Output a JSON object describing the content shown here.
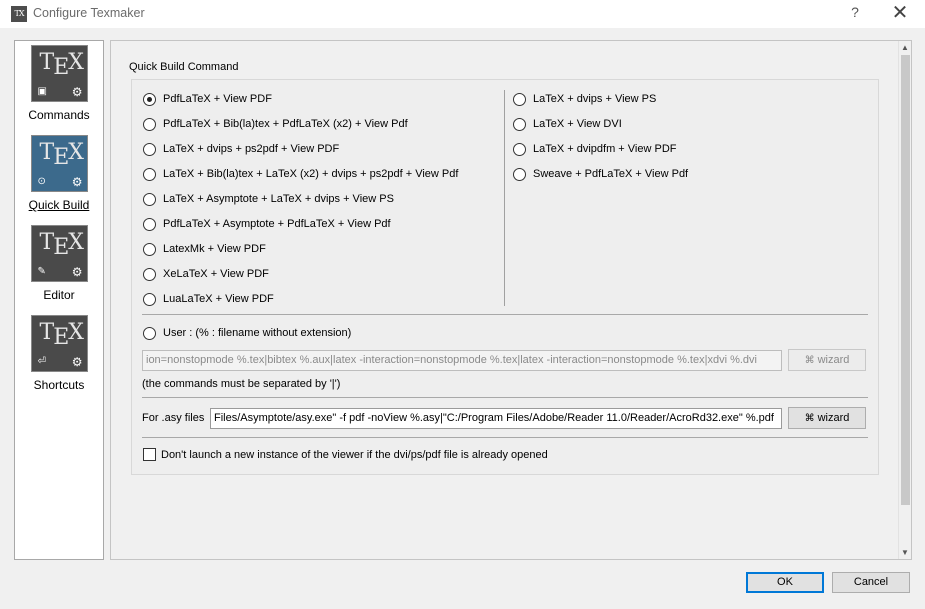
{
  "window": {
    "title": "Configure Texmaker",
    "help": "?",
    "close": "✕"
  },
  "sidebar": {
    "items": [
      {
        "label": "Commands",
        "icon": "commands-icon"
      },
      {
        "label": "Quick Build",
        "icon": "quick-build-icon",
        "selected": true
      },
      {
        "label": "Editor",
        "icon": "editor-icon"
      },
      {
        "label": "Shortcuts",
        "icon": "shortcuts-icon"
      }
    ],
    "icon_text": "TEX"
  },
  "quick_build": {
    "group_title": "Quick Build Command",
    "left_options": [
      "PdfLaTeX + View PDF",
      "PdfLaTeX + Bib(la)tex + PdfLaTeX (x2) + View Pdf",
      "LaTeX + dvips + ps2pdf + View PDF",
      "LaTeX + Bib(la)tex + LaTeX (x2) + dvips + ps2pdf + View Pdf",
      "LaTeX + Asymptote + LaTeX + dvips + View PS",
      "PdfLaTeX + Asymptote + PdfLaTeX + View Pdf",
      "LatexMk + View PDF",
      "XeLaTeX + View PDF",
      "LuaLaTeX + View PDF"
    ],
    "right_options": [
      "LaTeX + dvips + View PS",
      "LaTeX + View DVI",
      "LaTeX + dvipdfm + View PDF",
      "Sweave + PdfLaTeX + View Pdf"
    ],
    "selected": "PdfLaTeX + View PDF",
    "user_label": "User : (% : filename without extension)",
    "user_command": "ion=nonstopmode %.tex|bibtex %.aux|latex -interaction=nonstopmode %.tex|latex -interaction=nonstopmode %.tex|xdvi %.dvi",
    "wizard_label": "wizard",
    "separator_note": "(the commands must be separated by '|')",
    "asy_label": "For .asy files",
    "asy_command": "Files/Asymptote/asy.exe\" -f pdf -noView %.asy|\"C:/Program Files/Adobe/Reader 11.0/Reader/AcroRd32.exe\" %.pdf",
    "viewer_checkbox_label": "Don't launch a new instance of the viewer if the dvi/ps/pdf file is already opened",
    "viewer_checkbox_checked": false
  },
  "buttons": {
    "ok": "OK",
    "cancel": "Cancel"
  }
}
